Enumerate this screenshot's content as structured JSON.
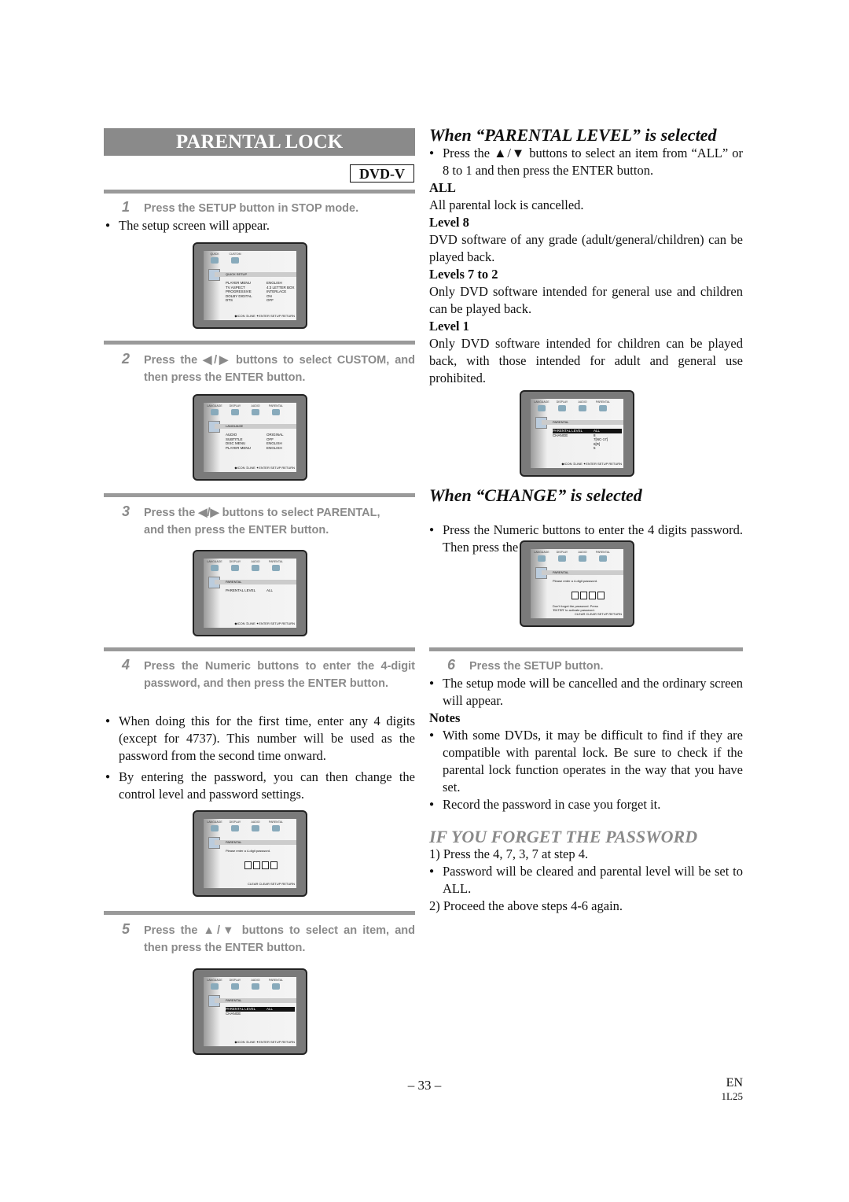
{
  "title": "PARENTAL LOCK",
  "badge": "DVD-V",
  "steps": {
    "s1": {
      "num": "1",
      "text": "Press the SETUP button in STOP mode."
    },
    "s1b": "The setup screen will appear.",
    "s2": {
      "num": "2",
      "text": "Press the ◀/▶ buttons to select CUSTOM, and then press the ENTER button."
    },
    "s3": {
      "num": "3",
      "text": "Press the ◀/▶ buttons to select PARENTAL, and then press the ENTER button."
    },
    "s4": {
      "num": "4",
      "text": "Press the Numeric buttons to enter the 4-digit password, and then press the ENTER button."
    },
    "s4b1": "When doing this for the first time, enter any 4 digits (except for 4737). This number will be used as the password from the second time onward.",
    "s4b2": "By entering the password, you can then change the control level and password settings.",
    "s5": {
      "num": "5",
      "text": "Press the ▲/▼ buttons to select an item, and then press the ENTER button."
    },
    "s6": {
      "num": "6",
      "text": "Press the SETUP button."
    },
    "s6b": "The setup mode will be cancelled and the ordinary screen will appear."
  },
  "level_section": {
    "heading": "When “PARENTAL LEVEL” is selected",
    "bullet": "Press the ▲/▼ buttons to select an item from “ALL” or 8 to 1 and then press the ENTER button.",
    "items": [
      {
        "label": "ALL",
        "text": "All parental lock is cancelled."
      },
      {
        "label": "Level 8",
        "text": "DVD software of any grade (adult/general/children) can be played back."
      },
      {
        "label": "Levels 7 to 2",
        "text": "Only DVD software intended for general use and children can be played back."
      },
      {
        "label": "Level 1",
        "text": "Only DVD software intended for children can be played back, with those intended for adult and general use prohibited."
      }
    ]
  },
  "change_section": {
    "heading": "When “CHANGE” is selected",
    "bullet": "Press the Numeric buttons to enter the 4 digits password. Then press the ENTER button."
  },
  "notes": {
    "heading": "Notes",
    "items": [
      "With some DVDs, it may be difficult to find if they are compatible with parental lock. Be sure to check if the parental lock function operates in the way that you have set.",
      "Record the password in case you forget it."
    ]
  },
  "forget": {
    "heading": "IF YOU FORGET THE PASSWORD",
    "l1": "1) Press the 4, 7, 3, 7 at step 4.",
    "b1": "Password will be cleared and parental level will be set to ALL.",
    "l2": "2) Proceed the above steps 4-6 again."
  },
  "footer": {
    "page": "– 33 –",
    "lang": "EN",
    "code": "1L25"
  },
  "screens": [
    {
      "tabs": [
        "QUICK",
        "CUSTOM"
      ],
      "title": "QUICK SETUP",
      "rows": [
        [
          "PLAYER MENU",
          "ENGLISH"
        ],
        [
          "TV ASPECT",
          "4:3 LETTER BOX"
        ],
        [
          "PROGRESSIVE",
          "INTERLACE"
        ],
        [
          "DOLBY DIGITAL",
          "ON"
        ],
        [
          "DTS",
          "OFF"
        ]
      ],
      "foot": "◆ICON  ⇕LINE  ✦ENTER  SETUP RETURN"
    },
    {
      "tabs": [
        "LANGUAGE",
        "DISPLAY",
        "AUDIO",
        "PARENTAL"
      ],
      "title": "LANGUAGE",
      "rows": [
        [
          "AUDIO",
          "ORIGINAL"
        ],
        [
          "SUBTITLE",
          "OFF"
        ],
        [
          "DISC MENU",
          "ENGLISH"
        ],
        [
          "PLAYER MENU",
          "ENGLISH"
        ]
      ],
      "foot": "◆ICON  ⇕LINE  ✦ENTER  SETUP RETURN"
    },
    {
      "tabs": [
        "LANGUAGE",
        "DISPLAY",
        "AUDIO",
        "PARENTAL"
      ],
      "title": "PARENTAL",
      "rows": [
        [
          "PARENTAL LEVEL",
          "ALL"
        ]
      ],
      "foot": "◆ICON  ⇕LINE  ✦ENTER  SETUP RETURN"
    },
    {
      "tabs": [
        "LANGUAGE",
        "DISPLAY",
        "AUDIO",
        "PARENTAL"
      ],
      "title": "PARENTAL",
      "msg": "Please enter a 4-digit password.",
      "foot": "CLEAR CLEAR  SETUP RETURN"
    },
    {
      "tabs": [
        "LANGUAGE",
        "DISPLAY",
        "AUDIO",
        "PARENTAL"
      ],
      "title": "PARENTAL",
      "rows": [
        [
          "PARENTAL LEVEL",
          "ALL"
        ],
        [
          "CHANGE",
          ""
        ]
      ],
      "sel": 0,
      "foot": "◆ICON  ⇕LINE  ✦ENTER  SETUP RETURN"
    },
    {
      "tabs": [
        "LANGUAGE",
        "DISPLAY",
        "AUDIO",
        "PARENTAL"
      ],
      "title": "PARENTAL",
      "rows": [
        [
          "PARENTAL LEVEL",
          "ALL"
        ],
        [
          "CHANGE",
          "8"
        ],
        [
          "",
          "7[NC-17]"
        ],
        [
          "",
          "6[R]"
        ],
        [
          "",
          "5"
        ]
      ],
      "sel": 0,
      "foot": "◆ICON  ⇕LINE  ✦ENTER  SETUP RETURN"
    },
    {
      "tabs": [
        "LANGUAGE",
        "DISPLAY",
        "AUDIO",
        "PARENTAL"
      ],
      "title": "PARENTAL",
      "msg": "Please enter a 4-digit password.",
      "msg2": "Don't forget the password. Press 'ENTER' to activate password.",
      "foot": "CLEAR CLEAR  SETUP RETURN"
    }
  ]
}
